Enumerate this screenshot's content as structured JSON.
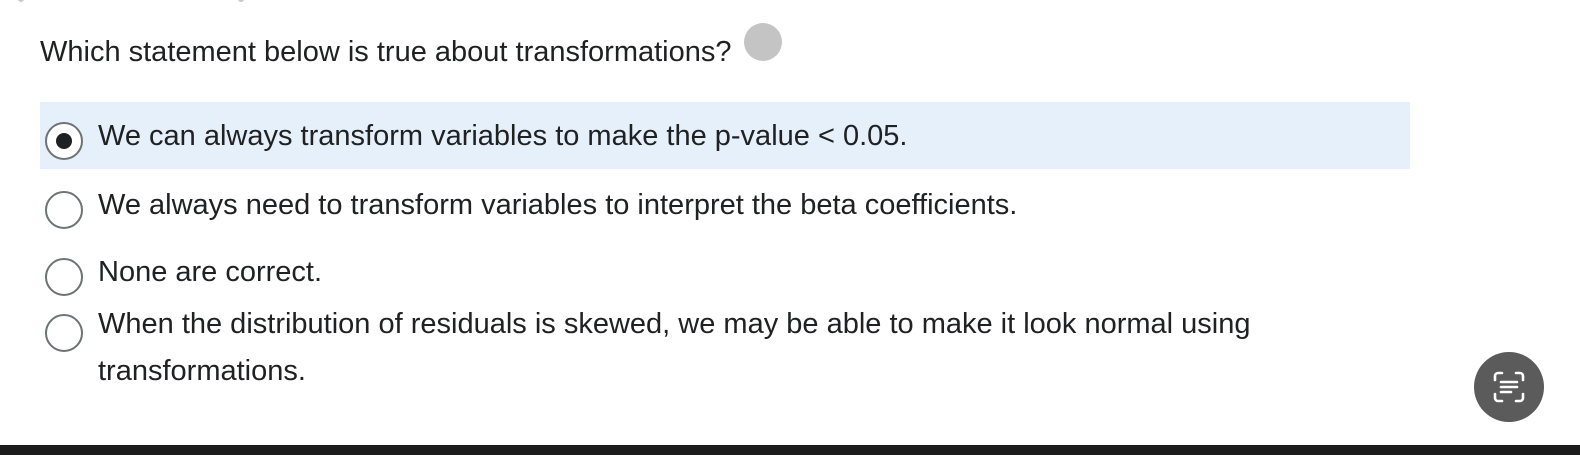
{
  "question": {
    "text": "Which statement below is true about transformations?"
  },
  "options": [
    {
      "label": "We can always transform variables to make the p-value < 0.05.",
      "selected": true
    },
    {
      "label": "We always need to transform variables to interpret the beta coefficients.",
      "selected": false
    },
    {
      "label": "None are correct.",
      "selected": false
    },
    {
      "label": "When the distribution of residuals is skewed, we may be able to make it look normal using transformations.",
      "selected": false
    }
  ],
  "colors": {
    "selected_background": "#e6f0fa",
    "status_dot": "#c4c4c4",
    "fab_background": "#5b5b5b",
    "bottom_bar": "#1c1c1c"
  },
  "icons": {
    "status": "status-dot-icon",
    "fab": "text-scan-icon"
  }
}
